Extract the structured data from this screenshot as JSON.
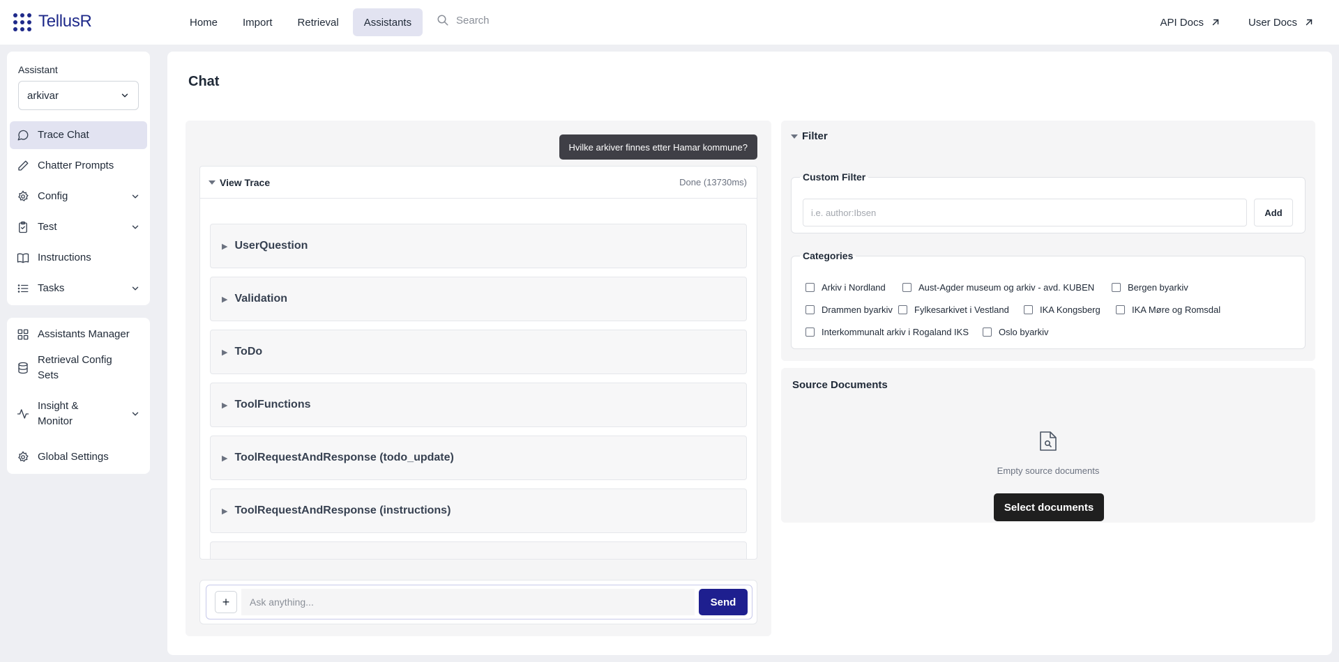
{
  "app": {
    "name": "TellusR",
    "brand_color": "#1f2a8a",
    "accent_color": "#1e1f8f"
  },
  "topnav": {
    "items": [
      {
        "label": "Home",
        "active": false
      },
      {
        "label": "Import",
        "active": false
      },
      {
        "label": "Retrieval",
        "active": false
      },
      {
        "label": "Assistants",
        "active": true
      }
    ],
    "search_placeholder": "Search",
    "api_docs": "API Docs",
    "user_docs": "User Docs"
  },
  "sidebar": {
    "assistant_label": "Assistant",
    "assistant_value": "arkivar",
    "items": [
      {
        "label": "Trace Chat",
        "icon": "chat-bubble-icon",
        "active": true
      },
      {
        "label": "Chatter Prompts",
        "icon": "pencil-icon"
      },
      {
        "label": "Config",
        "icon": "gear-icon",
        "expandable": true
      },
      {
        "label": "Test",
        "icon": "clipboard-icon",
        "expandable": true
      },
      {
        "label": "Instructions",
        "icon": "book-icon"
      },
      {
        "label": "Tasks",
        "icon": "list-icon",
        "expandable": true
      }
    ],
    "admin_items": [
      {
        "label": "Assistants Manager",
        "icon": "grid-icon"
      },
      {
        "label": "Retrieval Config Sets",
        "icon": "database-icon"
      },
      {
        "label": "Insight & Monitor",
        "icon": "activity-icon",
        "expandable": true
      },
      {
        "label": "Global Settings",
        "icon": "gear-icon"
      }
    ]
  },
  "main": {
    "title": "Chat"
  },
  "chat": {
    "user_message": "Hvilke arkiver finnes etter Hamar kommune?",
    "trace_title": "View Trace",
    "trace_status": "Done (13730ms)",
    "steps": [
      "UserQuestion",
      "Validation",
      "ToDo",
      "ToolFunctions",
      "ToolRequestAndResponse (todo_update)",
      "ToolRequestAndResponse (instructions)"
    ],
    "input_placeholder": "Ask anything...",
    "add_label": "+",
    "send_label": "Send"
  },
  "filter": {
    "title": "Filter",
    "custom_filter_legend": "Custom Filter",
    "custom_filter_placeholder": "i.e. author:Ibsen",
    "add_label": "Add",
    "categories_legend": "Categories",
    "categories": [
      "Arkiv i Nordland",
      "Aust-Agder museum og arkiv - avd. KUBEN",
      "Bergen byarkiv",
      "Drammen byarkiv",
      "Fylkesarkivet i Vestland",
      "IKA Kongsberg",
      "IKA Møre og Romsdal",
      "Interkommunalt arkiv i Rogaland IKS",
      "Oslo byarkiv"
    ]
  },
  "source_documents": {
    "title": "Source Documents",
    "empty_text": "Empty source documents",
    "select_label": "Select documents"
  }
}
